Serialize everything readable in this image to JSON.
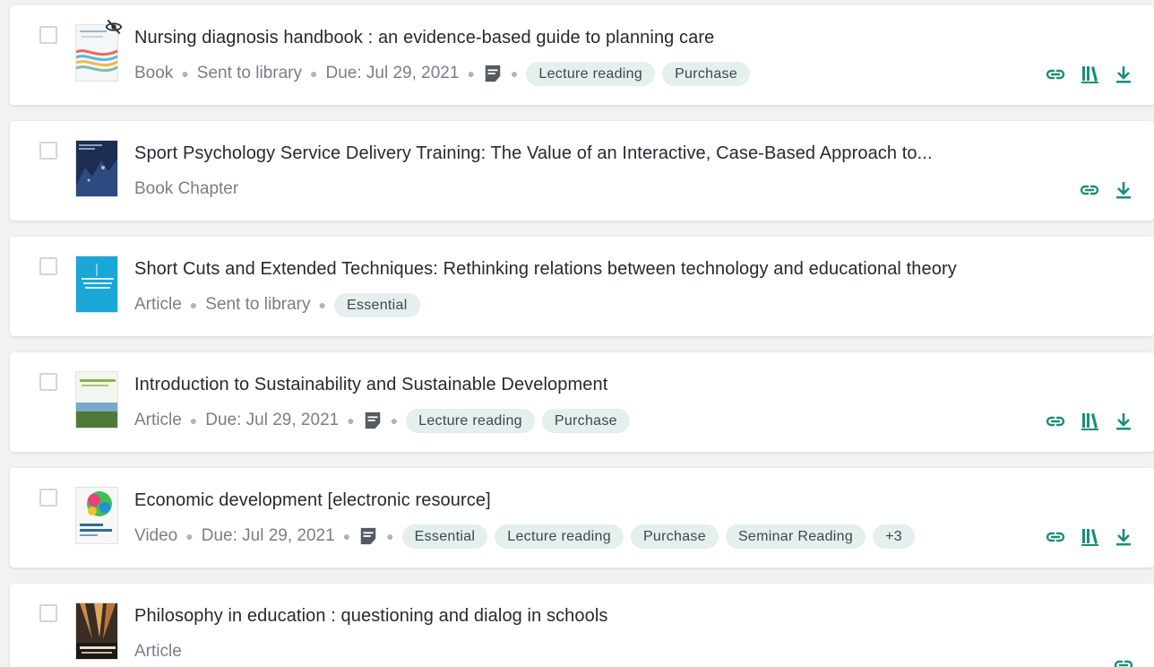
{
  "accent_color": "#1a8e7a",
  "items": [
    {
      "title": "Nursing diagnosis handbook : an evidence-based guide to planning care",
      "type": "Book",
      "status": "Sent to library",
      "due": "Due: Jul 29, 2021",
      "tags": [
        "Lecture reading",
        "Purchase"
      ],
      "has_note": true,
      "hidden": true,
      "actions": [
        "link-icon",
        "library-icon",
        "download-icon"
      ]
    },
    {
      "title": "Sport Psychology Service Delivery Training: The Value of an Interactive, Case-Based Approach to...",
      "type": "Book Chapter",
      "actions": [
        "link-icon",
        "download-icon"
      ]
    },
    {
      "title": "Short Cuts and Extended Techniques: Rethinking relations between technology and educational theory",
      "type": "Article",
      "status": "Sent to library",
      "tags": [
        "Essential"
      ],
      "actions": []
    },
    {
      "title": "Introduction to Sustainability and Sustainable Development",
      "type": "Article",
      "due": "Due: Jul 29, 2021",
      "tags": [
        "Lecture reading",
        "Purchase"
      ],
      "has_note": true,
      "actions": [
        "link-icon",
        "library-icon",
        "download-icon"
      ]
    },
    {
      "title": "Economic development [electronic resource]",
      "type": "Video",
      "due": "Due: Jul 29, 2021",
      "tags": [
        "Essential",
        "Lecture reading",
        "Purchase",
        "Seminar Reading",
        "+3"
      ],
      "has_note": true,
      "actions": [
        "link-icon",
        "library-icon",
        "download-icon"
      ]
    },
    {
      "title": "Philosophy in education : questioning and dialog in schools",
      "type": "Article",
      "actions": [
        "link-icon"
      ]
    }
  ]
}
